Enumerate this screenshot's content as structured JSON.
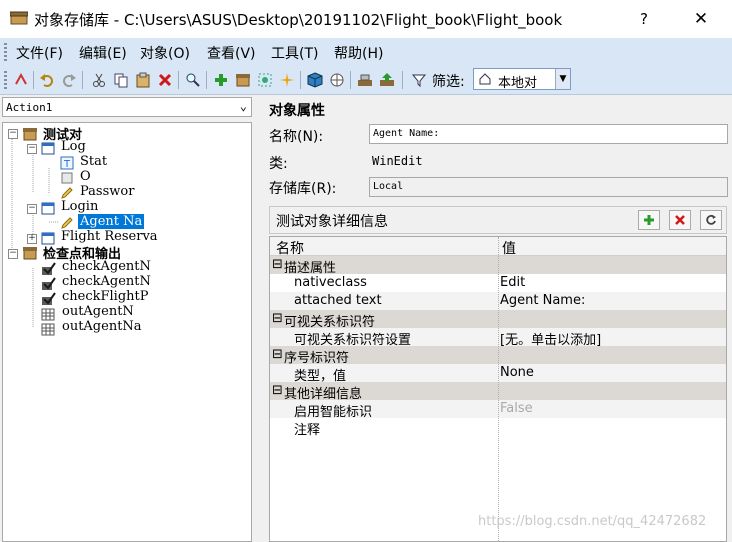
{
  "window": {
    "title": "对象存储库 - C:\\Users\\ASUS\\Desktop\\20191102\\Flight_book\\Flight_book",
    "help_button": "?",
    "close_button": "✕"
  },
  "menu": [
    "文件(F)",
    "编辑(E)",
    "对象(O)",
    "查看(V)",
    "工具(T)",
    "帮助(H)"
  ],
  "toolbar": {
    "filter_label": "筛选:",
    "filter_value": "本地对"
  },
  "left_panel": {
    "action_combo": "Action1",
    "tree": [
      {
        "label": "测试对",
        "bold": true
      },
      {
        "label": "Log"
      },
      {
        "label": "Stat"
      },
      {
        "label": "O"
      },
      {
        "label": "Passwor"
      },
      {
        "label": "Login"
      },
      {
        "label": "Agent Na"
      },
      {
        "label": "Flight Reserva"
      },
      {
        "label": "检查点和输出",
        "bold": true
      },
      {
        "label": "checkAgentN"
      },
      {
        "label": "checkAgentN"
      },
      {
        "label": "checkFlightP"
      },
      {
        "label": "outAgentN"
      },
      {
        "label": "outAgentNa"
      }
    ]
  },
  "properties": {
    "title": "对象属性",
    "name_label": "名称(N):",
    "name_value": "Agent Name:",
    "class_label": "类:",
    "class_value": "WinEdit",
    "repo_label": "存储库(R):",
    "repo_value": "Local"
  },
  "details": {
    "title": "测试对象详细信息",
    "col_name": "名称",
    "col_value": "值",
    "rows": [
      {
        "name": "描述属性",
        "value": ""
      },
      {
        "name": "nativeclass",
        "value": "Edit"
      },
      {
        "name": "attached text",
        "value": "Agent Name:"
      },
      {
        "name": "可视关系标识符",
        "value": ""
      },
      {
        "name": "可视关系标识符设置",
        "value": "[无。单击以添加]"
      },
      {
        "name": "序号标识符",
        "value": ""
      },
      {
        "name": "类型，值",
        "value": "None"
      },
      {
        "name": "其他详细信息",
        "value": ""
      },
      {
        "name": "启用智能标识",
        "value": "False"
      },
      {
        "name": "注释",
        "value": ""
      }
    ]
  },
  "watermark": "https://blog.csdn.net/qq_42472682"
}
